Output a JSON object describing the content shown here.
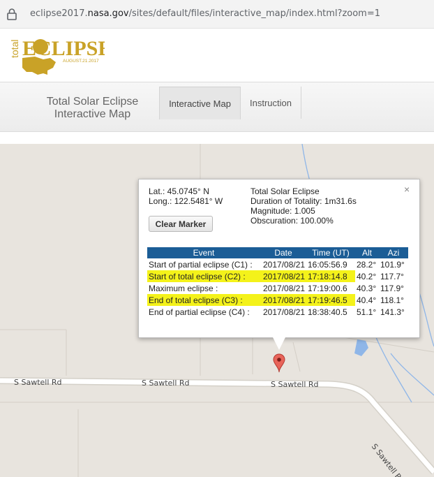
{
  "browser": {
    "url_prefix": "eclipse2017.",
    "url_domain": "nasa.gov",
    "url_path": "/sites/default/files/interactive_map/index.html?zoom=1"
  },
  "logo": {
    "total": "total",
    "eclipse": "ECLIPSE",
    "date": "AUGUST.21.2017"
  },
  "nav": {
    "title_line1": "Total Solar Eclipse",
    "title_line2": "Interactive Map",
    "tabs": [
      {
        "label": "Interactive Map",
        "active": true
      },
      {
        "label": "Instruction",
        "active": false
      }
    ]
  },
  "popup": {
    "lat": "Lat.: 45.0745° N",
    "long": "Long.: 122.5481° W",
    "clear_label": "Clear Marker",
    "eclipse_type": "Total Solar Eclipse",
    "duration": "Duration of Totality: 1m31.6s",
    "magnitude": "Magnitude: 1.005",
    "obscuration": "Obscuration: 100.00%",
    "close": "×",
    "table_headers": [
      "Event",
      "Date",
      "Time (UT)",
      "Alt",
      "Azi"
    ],
    "rows": [
      {
        "event": "Start of partial eclipse (C1) :",
        "date": "2017/08/21",
        "time": "16:05:56.9",
        "alt": "28.2°",
        "azi": "101.9°",
        "highlight": false
      },
      {
        "event": "Start of total eclipse (C2) :",
        "date": "2017/08/21",
        "time": "17:18:14.8",
        "alt": "40.2°",
        "azi": "117.7°",
        "highlight": true
      },
      {
        "event": "Maximum eclipse :",
        "date": "2017/08/21",
        "time": "17:19:00.6",
        "alt": "40.3°",
        "azi": "117.9°",
        "highlight": false
      },
      {
        "event": "End of total eclipse (C3) :",
        "date": "2017/08/21",
        "time": "17:19:46.5",
        "alt": "40.4°",
        "azi": "118.1°",
        "highlight": true
      },
      {
        "event": "End of partial eclipse (C4) :",
        "date": "2017/08/21",
        "time": "18:38:40.5",
        "alt": "51.1°",
        "azi": "141.3°",
        "highlight": false
      }
    ]
  },
  "map": {
    "roads": [
      "S Sawtell Rd",
      "S Sawtell Rd",
      "S Sawtell Rd",
      "S Sawtell Rd"
    ],
    "marker_icon": "map-pin-icon"
  },
  "colors": {
    "table_header": "#1b5d96",
    "highlight": "#f4f21a",
    "map_bg": "#e8e4de",
    "water": "#8fb6e8",
    "logo_gold": "#c9a227"
  }
}
